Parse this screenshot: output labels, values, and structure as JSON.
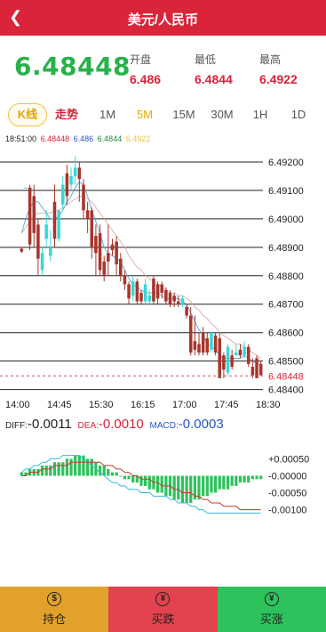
{
  "header": {
    "back_icon": "chevron-left-icon",
    "title": "美元/人民币"
  },
  "quote": {
    "price": "6.48448",
    "open_label": "开盘",
    "open_value": "6.486",
    "low_label": "最低",
    "low_value": "6.4844",
    "high_label": "最高",
    "high_value": "6.4922"
  },
  "tabs": [
    {
      "label": "K线",
      "active": false
    },
    {
      "label": "走势",
      "active": false
    },
    {
      "label": "1M",
      "active": false
    },
    {
      "label": "5M",
      "active": true
    },
    {
      "label": "15M",
      "active": false
    },
    {
      "label": "30M",
      "active": false
    },
    {
      "label": "1H",
      "active": false
    },
    {
      "label": "1D",
      "active": false
    }
  ],
  "legend": {
    "time": "18:51:00",
    "close": "6.48448",
    "open": "6.486",
    "low": "6.4844",
    "high": "6.4922"
  },
  "colors": {
    "up": "#36d8d8",
    "down": "#a8352c",
    "accent": "#d9243a",
    "green": "#27b24a",
    "gold": "#e3b53a",
    "hold": "#e2a12b",
    "buy": "#2ec25c"
  },
  "macd": {
    "diff_label": "DIFF:",
    "diff_value": "-0.0011",
    "dea_label": "DEA:",
    "dea_value": "-0.0010",
    "macd_label": "MACD:",
    "macd_value": "-0.0003"
  },
  "footer": {
    "hold_label": "持仓",
    "sell_label": "买跌",
    "buy_label": "买涨"
  },
  "chart_data": [
    {
      "type": "candlestick",
      "x_labels": [
        "14:00",
        "14:45",
        "15:30",
        "16:15",
        "17:00",
        "17:45",
        "18:30"
      ],
      "y_ticks": [
        "6.49200",
        "6.49100",
        "6.49000",
        "6.48900",
        "6.48800",
        "6.48700",
        "6.48600",
        "6.48500",
        "6.48400"
      ],
      "ylim": [
        6.4838,
        6.4925
      ],
      "current_price_label": "6.48448",
      "current_price": 6.48448,
      "candles": [
        [
          6.48895,
          6.48885,
          6.489,
          6.4888
        ],
        [
          6.4911,
          6.4911,
          6.4911,
          6.4911
        ],
        [
          6.4911,
          6.4891,
          6.4912,
          6.4889
        ],
        [
          6.4908,
          6.4895,
          6.4912,
          6.489
        ],
        [
          6.4898,
          6.4886,
          6.49,
          6.488
        ],
        [
          6.4882,
          6.4888,
          6.489,
          6.488
        ],
        [
          6.4893,
          6.4898,
          6.4903,
          6.489
        ],
        [
          6.4887,
          6.489,
          6.4896,
          6.4885
        ],
        [
          6.4906,
          6.4893,
          6.4912,
          6.489
        ],
        [
          6.4893,
          6.4903,
          6.4903,
          6.4892
        ],
        [
          6.4905,
          6.4912,
          6.4915,
          6.4903
        ],
        [
          6.4916,
          6.4908,
          6.4919,
          6.4905
        ],
        [
          6.4912,
          6.4915,
          6.4918,
          6.491
        ],
        [
          6.4915,
          6.4918,
          6.4922,
          6.4912
        ],
        [
          6.4918,
          6.4914,
          6.492,
          6.4906
        ],
        [
          6.4912,
          6.4903,
          6.4914,
          6.49
        ],
        [
          6.4903,
          6.49,
          6.4906,
          6.4895
        ],
        [
          6.4903,
          6.489,
          6.4904,
          6.4886
        ],
        [
          6.4894,
          6.4888,
          6.4898,
          6.488
        ],
        [
          6.4895,
          6.4882,
          6.4898,
          6.488
        ],
        [
          6.4885,
          6.488,
          6.4887,
          6.4878
        ],
        [
          6.4888,
          6.4885,
          6.4898,
          6.488
        ],
        [
          6.4891,
          6.4889,
          6.4893,
          6.4887
        ],
        [
          6.4892,
          6.4884,
          6.4894,
          6.488
        ],
        [
          6.4886,
          6.488,
          6.4888,
          6.4878
        ],
        [
          6.488,
          6.4877,
          6.4882,
          6.4875
        ],
        [
          6.4877,
          6.4872,
          6.4878,
          6.487
        ],
        [
          6.4873,
          6.4878,
          6.488,
          6.4871
        ],
        [
          6.4878,
          6.4871,
          6.4879,
          6.487
        ],
        [
          6.4874,
          6.4871,
          6.4875,
          6.487
        ],
        [
          6.4871,
          6.4877,
          6.4879,
          6.487
        ],
        [
          6.4871,
          6.4873,
          6.4875,
          6.487
        ],
        [
          6.4879,
          6.4871,
          6.488,
          6.487
        ],
        [
          6.4877,
          6.4872,
          6.4878,
          6.487
        ],
        [
          6.4877,
          6.4874,
          6.4878,
          6.4872
        ],
        [
          6.4875,
          6.4871,
          6.4876,
          6.487
        ],
        [
          6.4874,
          6.487,
          6.4875,
          6.4869
        ],
        [
          6.4873,
          6.4871,
          6.4874,
          6.4869
        ],
        [
          6.4871,
          6.487,
          6.4873,
          6.4869
        ],
        [
          6.487,
          6.4872,
          6.4873,
          6.4869
        ],
        [
          6.4869,
          6.4866,
          6.487,
          6.4865
        ],
        [
          6.4866,
          6.4853,
          6.4869,
          6.4852
        ],
        [
          6.4857,
          6.4854,
          6.4866,
          6.4852
        ],
        [
          6.4856,
          6.4853,
          6.486,
          6.4852
        ],
        [
          6.486,
          6.4853,
          6.4862,
          6.4852
        ],
        [
          6.4858,
          6.4853,
          6.486,
          6.4852
        ],
        [
          6.4854,
          6.486,
          6.486,
          6.4853
        ],
        [
          6.4859,
          6.4853,
          6.486,
          6.4852
        ],
        [
          6.4858,
          6.4844,
          6.486,
          6.4844
        ],
        [
          6.4852,
          6.4847,
          6.4853,
          6.4844
        ],
        [
          6.4846,
          6.4855,
          6.4856,
          6.4845
        ],
        [
          6.4852,
          6.4848,
          6.4854,
          6.4847
        ],
        [
          6.4852,
          6.4853,
          6.4856,
          6.4852
        ],
        [
          6.4854,
          6.4852,
          6.4856,
          6.4851
        ],
        [
          6.4852,
          6.4855,
          6.4857,
          6.4851
        ],
        [
          6.4855,
          6.4849,
          6.4856,
          6.4848
        ],
        [
          6.4848,
          6.4845,
          6.4851,
          6.4844
        ],
        [
          6.4851,
          6.4844,
          6.4852,
          6.4844
        ],
        [
          6.4849,
          6.4845,
          6.485,
          6.4845
        ]
      ],
      "series": [
        {
          "name": "MA",
          "color": "#3aa1d8",
          "values": [
            6.4895,
            6.49,
            6.4904,
            6.4906,
            6.4906,
            6.4904,
            6.4902,
            6.49,
            6.49,
            6.4901,
            6.4903,
            6.4906,
            6.4908,
            6.4911,
            6.4913,
            6.4912,
            6.4908,
            6.4903,
            6.4899,
            6.4895,
            6.489,
            6.4888,
            6.4887,
            6.4886,
            6.4885,
            6.4882,
            6.4879,
            6.4877,
            6.4876,
            6.4875,
            6.4874,
            6.4874,
            6.4874,
            6.4874,
            6.4873,
            6.4872,
            6.4872,
            6.4872,
            6.4872,
            6.4871,
            6.487,
            6.4867,
            6.4864,
            6.4861,
            6.4859,
            6.4856,
            6.4855,
            6.4854,
            6.4852,
            6.4851,
            6.4851,
            6.4851,
            6.4851,
            6.4851,
            6.4852,
            6.4851,
            6.485,
            6.4849,
            6.4849
          ]
        },
        {
          "name": "MA",
          "color": "#d9a0a0",
          "values": [
            6.4895,
            6.4897,
            6.4899,
            6.4901,
            6.4902,
            6.4902,
            6.4902,
            6.4902,
            6.4903,
            6.4903,
            6.4904,
            6.4905,
            6.4906,
            6.4907,
            6.4908,
            6.4908,
            6.4907,
            6.4906,
            6.4904,
            6.4902,
            6.49,
            6.4898,
            6.4896,
            6.4894,
            6.4892,
            6.489,
            6.4887,
            6.4885,
            6.4883,
            6.4882,
            6.488,
            6.4879,
            6.4878,
            6.4877,
            6.4876,
            6.4875,
            6.4874,
            6.4874,
            6.4873,
            6.4873,
            6.4872,
            6.4871,
            6.4869,
            6.4868,
            6.4866,
            6.4865,
            6.4863,
            6.4862,
            6.486,
            6.4859,
            6.4858,
            6.4857,
            6.4856,
            6.4856,
            6.4855,
            6.4854,
            6.4853,
            6.4852,
            6.4851
          ]
        }
      ]
    },
    {
      "type": "macd",
      "y_ticks": [
        "+0.00050",
        "-0.00000",
        "-0.00050",
        "-0.00100"
      ],
      "ylim": [
        -0.0013,
        0.0008
      ],
      "histogram": [
        0.0001,
        0.0001,
        0.0002,
        0.0002,
        0.0002,
        0.0003,
        0.0003,
        0.0003,
        0.0004,
        0.0004,
        0.0004,
        0.0005,
        0.0005,
        0.0006,
        0.0006,
        0.0006,
        0.0005,
        0.0005,
        0.0004,
        0.0003,
        0.0003,
        0.0002,
        0.0001,
        0.0001,
        0.0,
        -0.0001,
        -0.0001,
        -0.0002,
        -0.0002,
        -0.0003,
        -0.0003,
        -0.0004,
        -0.0004,
        -0.0005,
        -0.0005,
        -0.0006,
        -0.0006,
        -0.0007,
        -0.0007,
        -0.0008,
        -0.0008,
        -0.0008,
        -0.0007,
        -0.0007,
        -0.0006,
        -0.0006,
        -0.0005,
        -0.0005,
        -0.0004,
        -0.0004,
        -0.0004,
        -0.0003,
        -0.0003,
        -0.0002,
        -0.0002,
        -0.0002,
        -0.0001,
        -0.0001,
        -0.0001
      ],
      "series": [
        {
          "name": "DIFF",
          "color": "#36b8e0",
          "values": [
            0.0001,
            0.0002,
            0.0002,
            0.0003,
            0.0003,
            0.0004,
            0.0004,
            0.0005,
            0.0005,
            0.0005,
            0.0006,
            0.0006,
            0.0006,
            0.0006,
            0.0006,
            0.0005,
            0.0004,
            0.0003,
            0.0002,
            0.0001,
            0.0,
            -0.0001,
            -0.0002,
            -0.0002,
            -0.0003,
            -0.0003,
            -0.0004,
            -0.0004,
            -0.0004,
            -0.0005,
            -0.0005,
            -0.0005,
            -0.0006,
            -0.0006,
            -0.0006,
            -0.0006,
            -0.0007,
            -0.0007,
            -0.0008,
            -0.0008,
            -0.0008,
            -0.0009,
            -0.0009,
            -0.001,
            -0.001,
            -0.0011,
            -0.0011,
            -0.0011,
            -0.0011,
            -0.0011,
            -0.0011,
            -0.0011,
            -0.0011,
            -0.0011,
            -0.0011,
            -0.0011,
            -0.0011,
            -0.0011,
            -0.0011
          ]
        },
        {
          "name": "DEA",
          "color": "#c0392b",
          "values": [
            0.0,
            0.0,
            0.0001,
            0.0001,
            0.0001,
            0.0002,
            0.0002,
            0.0002,
            0.0003,
            0.0003,
            0.0003,
            0.0003,
            0.0004,
            0.0004,
            0.0004,
            0.0004,
            0.0004,
            0.0004,
            0.0004,
            0.0004,
            0.0003,
            0.0003,
            0.0003,
            0.0002,
            0.0002,
            0.0001,
            0.0001,
            0.0,
            0.0,
            -0.0001,
            -0.0001,
            -0.0001,
            -0.0002,
            -0.0002,
            -0.0003,
            -0.0003,
            -0.0003,
            -0.0004,
            -0.0004,
            -0.0005,
            -0.0005,
            -0.0005,
            -0.0006,
            -0.0006,
            -0.0007,
            -0.0007,
            -0.0008,
            -0.0008,
            -0.0008,
            -0.0009,
            -0.0009,
            -0.0009,
            -0.0009,
            -0.001,
            -0.001,
            -0.001,
            -0.001,
            -0.001,
            -0.001
          ]
        }
      ]
    }
  ]
}
